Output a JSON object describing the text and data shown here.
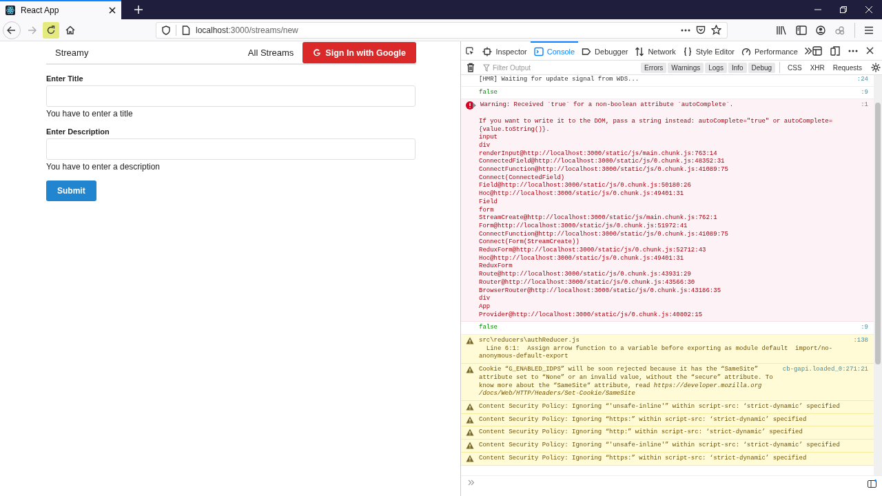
{
  "browser": {
    "tab": {
      "title": "React App",
      "selected": true
    },
    "nav_buttons": [
      {
        "disabled": false,
        "highlighted": false
      },
      {
        "disabled": true,
        "highlighted": false
      },
      {
        "disabled": false,
        "highlighted": true
      },
      {
        "disabled": false,
        "highlighted": false
      }
    ],
    "url": {
      "host": "localhost",
      "path": ":3000/streams/new"
    }
  },
  "page": {
    "brand": "Streamy",
    "link": "All Streams",
    "sign_in": "Sign In with Google",
    "fields": [
      {
        "label": "Enter Title",
        "error": "You have to enter a title"
      },
      {
        "label": "Enter Description",
        "error": "You have to enter a description"
      }
    ],
    "submit": "Submit"
  },
  "devtools": {
    "tools": [
      {
        "label": "Inspector",
        "selected": false
      },
      {
        "label": "Console",
        "selected": true
      },
      {
        "label": "Debugger",
        "selected": false
      },
      {
        "label": "Network",
        "selected": false
      },
      {
        "label": "Style Editor",
        "selected": false
      },
      {
        "label": "Performance",
        "selected": false
      }
    ],
    "filter": {
      "placeholder": "Filter Output"
    },
    "levels": [
      {
        "label": "Errors",
        "on": true
      },
      {
        "label": "Warnings",
        "on": true
      },
      {
        "label": "Logs",
        "on": true
      },
      {
        "label": "Info",
        "on": true
      },
      {
        "label": "Debug",
        "on": true
      }
    ],
    "requests": [
      {
        "label": "CSS",
        "on": false
      },
      {
        "label": "XHR",
        "on": false
      },
      {
        "label": "Requests",
        "on": false
      }
    ],
    "messages": [
      {
        "kind": "log",
        "text": "[HMR] Waiting for update signal from WDS...",
        "location": ":24"
      },
      {
        "kind": "value",
        "text": "false",
        "location": ":9"
      },
      {
        "kind": "error",
        "expanded": false,
        "text": "Warning: Received `true` for a non-boolean attribute `autoComplete`.",
        "location": ":1",
        "details": [
          "If you want to write it to the DOM, pass a string instead: autoComplete=\"true\" or autoComplete={value.toString()}.",
          "input",
          "div",
          "renderInput@http://localhost:3000/static/js/main.chunk.js:763:14",
          "ConnectedField@http://localhost:3000/static/js/0.chunk.js:48352:31",
          "ConnectFunction@http://localhost:3000/static/js/0.chunk.js:41089:75",
          "Connect(ConnectedField)",
          "Field@http://localhost:3000/static/js/0.chunk.js:50180:26",
          "Hoc@http://localhost:3000/static/js/0.chunk.js:49401:31",
          "Field",
          "form",
          "StreamCreate@http://localhost:3000/static/js/main.chunk.js:762:1",
          "Form@http://localhost:3000/static/js/0.chunk.js:51972:41",
          "ConnectFunction@http://localhost:3000/static/js/0.chunk.js:41089:75",
          "Connect(Form(StreamCreate))",
          "ReduxForm@http://localhost:3000/static/js/0.chunk.js:52712:43",
          "Hoc@http://localhost:3000/static/js/0.chunk.js:49401:31",
          "ReduxForm",
          "Route@http://localhost:3000/static/js/0.chunk.js:43931:29",
          "Router@http://localhost:3000/static/js/0.chunk.js:43566:30",
          "BrowserRouter@http://localhost:3000/static/js/0.chunk.js:43186:35",
          "div",
          "App",
          "Provider@http://localhost:3000/static/js/0.chunk.js:40802:15"
        ]
      },
      {
        "kind": "value",
        "text": "false",
        "location": ":9"
      },
      {
        "kind": "warning",
        "text": "src\\reducers\\authReducer.js",
        "location": ":138",
        "details": [
          "  Line 6:1:  Assign arrow function to a variable before exporting as module default  import/no-anonymous-default-export"
        ]
      },
      {
        "kind": "warning",
        "text": "Cookie “G_ENABLED_IDPS” will be soon rejected because it has the “SameSite” attribute set to “None” or an invalid value, without the “secure” attribute. To know more about the “SameSite“ attribute, read *https://developer.mozilla.org /docs/Web/HTTP/Headers/Set-Cookie/SameSite*",
        "location": "cb-gapi.loaded_0:271:21"
      },
      {
        "kind": "warning",
        "text": "Content Security Policy: Ignoring “'unsafe-inline'” within script-src: ‘strict-dynamic’ specified"
      },
      {
        "kind": "warning",
        "text": "Content Security Policy: Ignoring “https:” within script-src: ‘strict-dynamic’ specified"
      },
      {
        "kind": "warning",
        "text": "Content Security Policy: Ignoring “http:” within script-src: ‘strict-dynamic’ specified"
      },
      {
        "kind": "warning",
        "text": "Content Security Policy: Ignoring “'unsafe-inline'” within script-src: ‘strict-dynamic’ specified"
      },
      {
        "kind": "warning",
        "text": "Content Security Policy: Ignoring “https:” within script-src: ‘strict-dynamic’ specified"
      }
    ]
  }
}
